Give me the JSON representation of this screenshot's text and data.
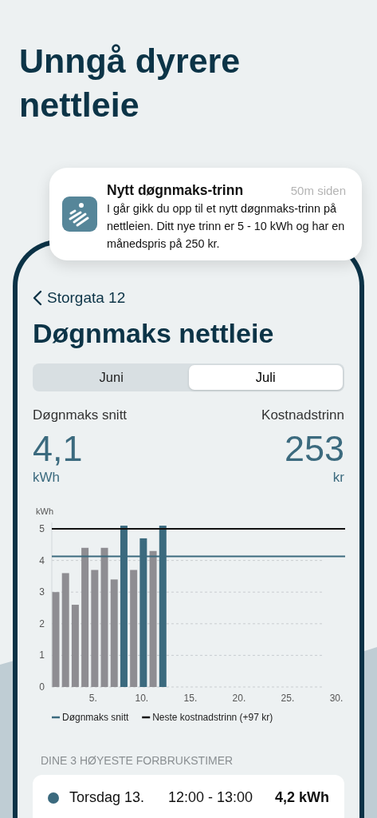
{
  "headline": "Unngå dyrere nettleie",
  "notification": {
    "title": "Nytt døgnmaks-trinn",
    "time": "50m siden",
    "body": "I går gikk du opp til et nytt døgnmaks-trinn på nettleien. Ditt nye trinn er 5 - 10 kWh og har en månedspris på 250 kr."
  },
  "back": {
    "label": "Storgata 12"
  },
  "title": "Døgnmaks nettleie",
  "tabs": [
    {
      "label": "Juni",
      "selected": false
    },
    {
      "label": "Juli",
      "selected": true
    }
  ],
  "stats": [
    {
      "label": "Døgnmaks snitt",
      "value": "4,1",
      "unit": "kWh"
    },
    {
      "label": "Kostnadstrinn",
      "value": "253",
      "unit": "kr"
    }
  ],
  "chart": {
    "chart_data": {
      "type": "bar",
      "ylabel": "kWh",
      "x": [
        1,
        2,
        3,
        4,
        5,
        6,
        7,
        8,
        9,
        10,
        11,
        12
      ],
      "xlim": [
        1,
        30
      ],
      "ylim": [
        0,
        5.2
      ],
      "grid": true,
      "legend": "bottom",
      "yticks": [
        0,
        1,
        2,
        3,
        4,
        5
      ],
      "xticks": [
        {
          "value": 5,
          "label": "5."
        },
        {
          "value": 10,
          "label": "10."
        },
        {
          "value": 15,
          "label": "15."
        },
        {
          "value": 20,
          "label": "20."
        },
        {
          "value": 25,
          "label": "25."
        },
        {
          "value": 30,
          "label": "30."
        }
      ],
      "series": [
        {
          "color": "#8e8d92",
          "values": [
            3.0,
            3.6,
            2.6,
            4.4,
            3.7,
            4.4,
            3.4,
            null,
            3.7,
            null,
            4.3,
            null
          ]
        },
        {
          "color": "#3b6a7e",
          "values": [
            null,
            null,
            null,
            null,
            null,
            null,
            null,
            5.1,
            null,
            4.7,
            null,
            5.1
          ]
        }
      ],
      "ref_lines": [
        {
          "axis": "y",
          "value": 4.13,
          "label": "Døgnmaks snitt",
          "color": "#3b6a7e"
        },
        {
          "axis": "y",
          "value": 5.0,
          "label": "Neste kostnadstrinn (+97 kr)",
          "color": "#111111"
        }
      ]
    }
  },
  "top_hours": {
    "heading": "DINE 3 HØYESTE FORBRUKSTIMER",
    "rows": [
      {
        "day": "Torsdag 13.",
        "time": "12:00 - 13:00",
        "usage": "4,2 kWh",
        "color": "#3b6a7e"
      }
    ]
  }
}
